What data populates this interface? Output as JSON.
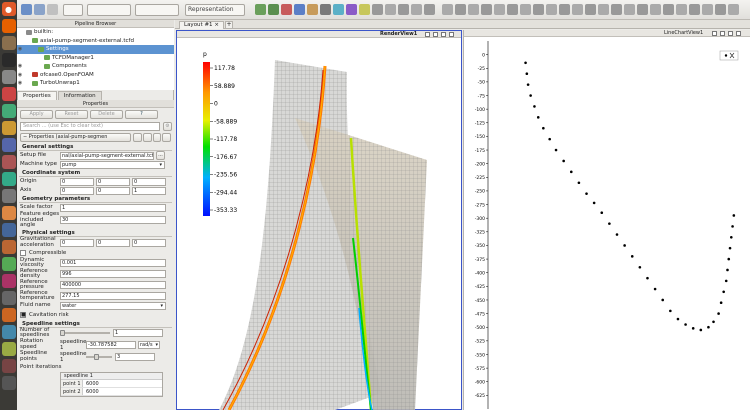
{
  "toolbar": {
    "representation": "Representation"
  },
  "pipeline": {
    "title": "Pipeline Browser",
    "items": [
      {
        "label": "builtin:",
        "indent": 0,
        "selected": false,
        "eye": false
      },
      {
        "label": "axial-pump-segment-external.tcfd",
        "indent": 1,
        "selected": false,
        "eye": false
      },
      {
        "label": "Settings",
        "indent": 2,
        "selected": true,
        "eye": true
      },
      {
        "label": "TCFDManager1",
        "indent": 3,
        "selected": false,
        "eye": false
      },
      {
        "label": "Components",
        "indent": 3,
        "selected": false,
        "eye": true
      },
      {
        "label": "ofcase0.OpenFOAM",
        "indent": 1,
        "selected": false,
        "eye": true
      },
      {
        "label": "TurboUnwrap1",
        "indent": 1,
        "selected": false,
        "eye": true
      }
    ]
  },
  "tabs": {
    "properties": "Properties",
    "information": "Information"
  },
  "props": {
    "title": "Properties",
    "apply": "Apply",
    "reset": "Reset",
    "delete": "Delete",
    "help": "?",
    "search_placeholder": "Search ... (use Esc to clear text)",
    "header_label": "Properties (axial-pump-segmen",
    "general": {
      "heading": "General settings",
      "setup_file_label": "Setup file",
      "setup_file_value": "nal/axial-pump-segment-external.tcfd",
      "browse": "...",
      "machine_type_label": "Machine type",
      "machine_type_value": "pump"
    },
    "coord": {
      "heading": "Coordinate system",
      "origin_label": "Origin",
      "origin": [
        "0",
        "0",
        "0"
      ],
      "axis_label": "Axis",
      "axis": [
        "0",
        "0",
        "1"
      ]
    },
    "geometry": {
      "heading": "Geometry parameters",
      "scale_label": "Scale factor",
      "scale_value": "1",
      "feature_label": "Feature edges included angle",
      "feature_value": "30"
    },
    "physical": {
      "heading": "Physical settings",
      "grav_label": "Gravitational acceleration",
      "grav": [
        "0",
        "0",
        "0"
      ],
      "compressible": "Compressible",
      "viscosity_label": "Dynamic viscosity",
      "viscosity_value": "0.001",
      "density_label": "Reference density",
      "density_value": "996",
      "pressure_label": "Reference pressure",
      "pressure_value": "400000",
      "temperature_label": "Reference temperature",
      "temperature_value": "277.15",
      "fluid_label": "Fluid name",
      "fluid_value": "water",
      "cavitation": "Cavitation risk"
    },
    "speedline": {
      "heading": "Speedline settings",
      "num_label": "Number of speedlines",
      "num_value": "1",
      "rot_label": "Rotation speed",
      "rot_sub": "speedline 1",
      "rot_value": "-30.787582",
      "rot_unit": "rad/s",
      "pts_label": "Speedline points",
      "pts_sub": "speedline 1",
      "pts_value": "3",
      "iter_label": "Point iterations",
      "iter_sub": "speedline 1",
      "iter_rows": [
        {
          "name": "point 1",
          "value": "6000"
        },
        {
          "name": "point 2",
          "value": "6000"
        }
      ]
    }
  },
  "layout": {
    "tab": "Layout #1",
    "plus": "+"
  },
  "render_view": {
    "name": "RenderView1",
    "legend_title": "p",
    "legend_ticks": [
      "117.78",
      "58.889",
      "0",
      "-58.889",
      "-117.78",
      "-176.67",
      "-235.56",
      "-294.44",
      "-353.33"
    ]
  },
  "line_chart": {
    "name": "LineChartView1",
    "chart_data": {
      "type": "scatter",
      "y_ticks": [
        "0",
        "-25",
        "-50",
        "-75",
        "-100",
        "-125",
        "-150",
        "-175",
        "-200",
        "-225",
        "-250",
        "-275",
        "-300",
        "-325",
        "-350",
        "-375",
        "-400",
        "-425",
        "-450",
        "-475",
        "-500",
        "-525",
        "-550",
        "-575",
        "-600",
        "-625"
      ],
      "ylim": [
        -650,
        25
      ],
      "xlim": [
        0,
        1
      ],
      "series": [
        {
          "points": [
            [
              0.14,
              -15
            ],
            [
              0.145,
              -35
            ],
            [
              0.15,
              -55
            ],
            [
              0.16,
              -75
            ],
            [
              0.175,
              -95
            ],
            [
              0.19,
              -115
            ],
            [
              0.21,
              -135
            ],
            [
              0.235,
              -155
            ],
            [
              0.26,
              -175
            ],
            [
              0.29,
              -195
            ],
            [
              0.32,
              -215
            ],
            [
              0.35,
              -235
            ],
            [
              0.38,
              -255
            ],
            [
              0.41,
              -272
            ],
            [
              0.44,
              -290
            ],
            [
              0.47,
              -310
            ],
            [
              0.5,
              -330
            ],
            [
              0.53,
              -350
            ],
            [
              0.56,
              -370
            ],
            [
              0.59,
              -390
            ],
            [
              0.62,
              -410
            ],
            [
              0.65,
              -430
            ],
            [
              0.68,
              -450
            ],
            [
              0.71,
              -470
            ],
            [
              0.74,
              -485
            ],
            [
              0.77,
              -495
            ],
            [
              0.8,
              -502
            ],
            [
              0.83,
              -505
            ],
            [
              0.86,
              -500
            ],
            [
              0.88,
              -490
            ],
            [
              0.9,
              -475
            ],
            [
              0.91,
              -455
            ],
            [
              0.92,
              -435
            ],
            [
              0.93,
              -415
            ],
            [
              0.935,
              -395
            ],
            [
              0.94,
              -375
            ],
            [
              0.945,
              -355
            ],
            [
              0.95,
              -335
            ],
            [
              0.955,
              -315
            ],
            [
              0.96,
              -295
            ]
          ]
        }
      ]
    }
  }
}
